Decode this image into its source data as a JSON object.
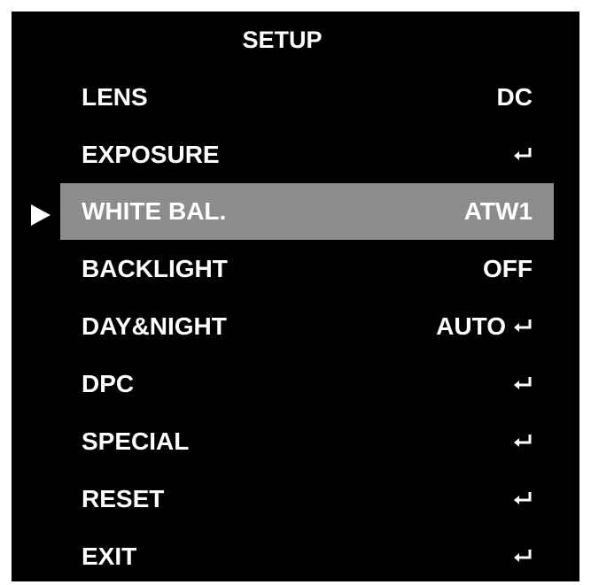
{
  "menu": {
    "title": "SETUP",
    "items": [
      {
        "label": "LENS",
        "value": "DC",
        "enter": false,
        "selected": false
      },
      {
        "label": "EXPOSURE",
        "value": "",
        "enter": true,
        "selected": false
      },
      {
        "label": "WHITE BAL.",
        "value": "ATW1",
        "enter": false,
        "selected": true
      },
      {
        "label": "BACKLIGHT",
        "value": "OFF",
        "enter": false,
        "selected": false
      },
      {
        "label": "DAY&NIGHT",
        "value": "AUTO",
        "enter": true,
        "selected": false
      },
      {
        "label": "DPC",
        "value": "",
        "enter": true,
        "selected": false
      },
      {
        "label": "SPECIAL",
        "value": "",
        "enter": true,
        "selected": false
      },
      {
        "label": "RESET",
        "value": "",
        "enter": true,
        "selected": false
      },
      {
        "label": "EXIT",
        "value": "",
        "enter": true,
        "selected": false
      }
    ]
  },
  "colors": {
    "background": "#000000",
    "text": "#ffffff",
    "selected_row": "#8c8c8c"
  },
  "icons": {
    "cursor": "triangle-right-icon",
    "enter": "enter-return-icon"
  }
}
